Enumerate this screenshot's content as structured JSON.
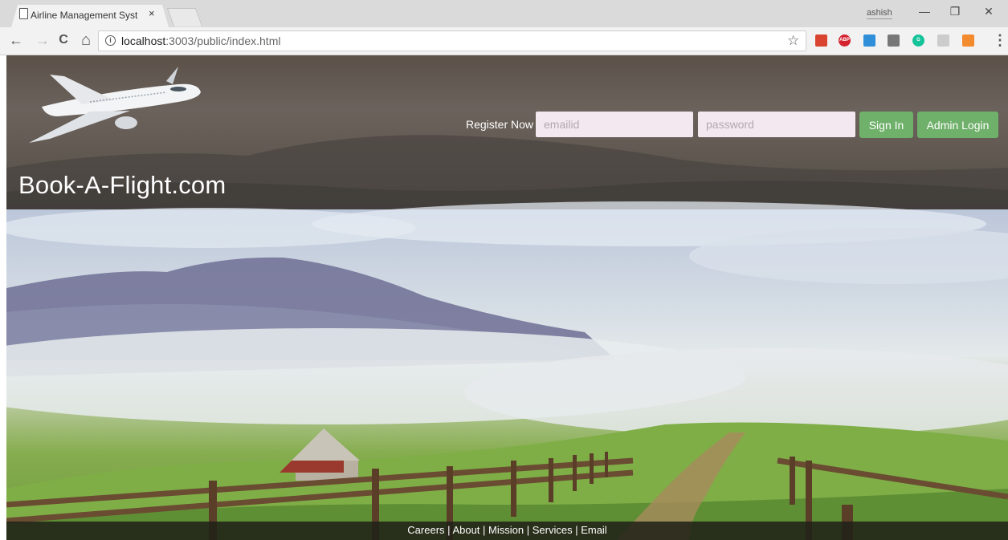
{
  "browser": {
    "tab_title": "Airline Management Syst",
    "tab_close": "×",
    "profile_name": "ashish",
    "window_controls": {
      "minimize": "—",
      "restore": "❐",
      "close": "✕"
    },
    "nav": {
      "back": "←",
      "forward": "→",
      "reload": "C",
      "home": "⌂"
    },
    "url_host": "localhost",
    "url_rest": ":3003/public/index.html",
    "bookmark_icon": "☆",
    "menu_icon": "⋮",
    "extensions": [
      {
        "name": "red-bookmark-extension-icon",
        "color": "#d9432f",
        "label": ""
      },
      {
        "name": "adblock-plus-extension-icon",
        "color": "#d4232f",
        "label": "ABP"
      },
      {
        "name": "blue-window-extension-icon",
        "color": "#2f8fd8",
        "label": ""
      },
      {
        "name": "gray-square-extension-icon",
        "color": "#777777",
        "label": ""
      },
      {
        "name": "grammarly-extension-icon",
        "color": "#15c39a",
        "label": "G"
      },
      {
        "name": "gray-leaf-extension-icon",
        "color": "#cccccc",
        "label": ""
      },
      {
        "name": "colorful-extension-icon",
        "color": "#f28a2e",
        "label": ""
      }
    ]
  },
  "header": {
    "brand": "Book-A-Flight.com",
    "register_label": "Register Now",
    "email_placeholder": "emailid",
    "password_placeholder": "password",
    "sign_in_label": "Sign In",
    "admin_login_label": "Admin Login",
    "button_color": "#6fb06a"
  },
  "footer": {
    "links": [
      "Careers",
      "About",
      "Mission",
      "Services",
      "Email"
    ],
    "separator": " | "
  }
}
